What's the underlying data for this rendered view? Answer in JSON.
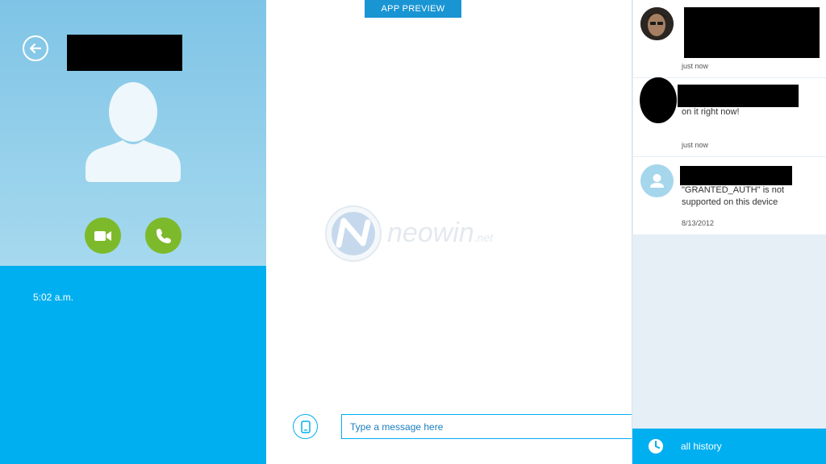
{
  "banner": {
    "label": "APP PREVIEW"
  },
  "contact": {
    "local_time": "5:02  a.m."
  },
  "watermark": {
    "brand": "neowin",
    "suffix": ".net"
  },
  "composer": {
    "placeholder": "Type a message here"
  },
  "recent": [
    {
      "message": "",
      "time": "just now"
    },
    {
      "message": "on it right now!",
      "time": "just now"
    },
    {
      "message": "\"GRANTED_AUTH\" is not supported on this device",
      "time": "8/13/2012"
    }
  ],
  "history": {
    "label": "all history"
  },
  "colors": {
    "accent": "#00aff0",
    "call_green": "#7dba2b",
    "banner": "#1a95d4"
  },
  "icons": [
    "back-arrow-icon",
    "video-camera-icon",
    "phone-icon",
    "mobile-device-icon",
    "clock-icon",
    "default-avatar-icon"
  ]
}
